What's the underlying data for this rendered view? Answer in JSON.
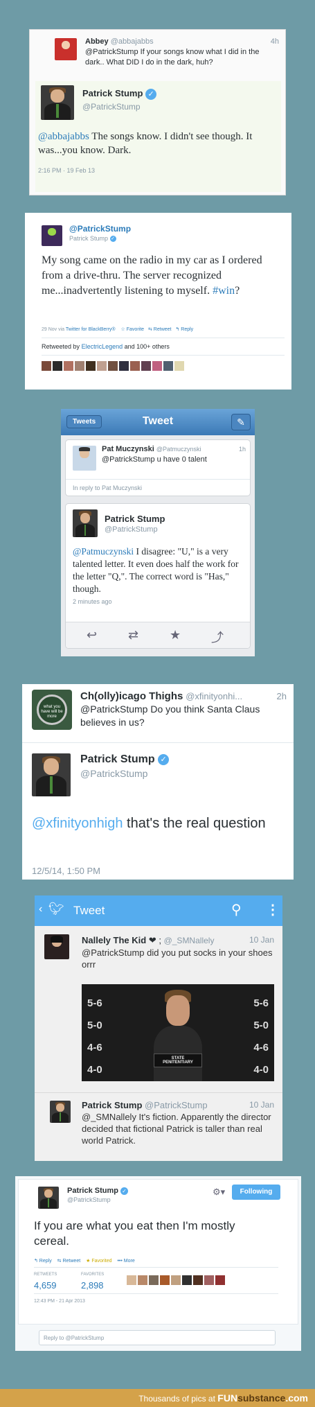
{
  "tweet1": {
    "reply_name": "Abbey",
    "reply_handle": "@abbajabbs",
    "reply_time": "4h",
    "reply_text": "@PatrickStump If your songs know what I did in the dark.. What DID I do in the dark, huh?",
    "name": "Patrick Stump",
    "handle": "@PatrickStump",
    "mention": "@abbajabbs",
    "text": " The songs know. I didn't see though. It was...you know. Dark.",
    "timestamp": "2:16 PM · 19 Feb 13"
  },
  "tweet2": {
    "handle": "@PatrickStump",
    "name": "Patrick Stump",
    "text": "My song came on the radio in my car as I ordered from a drive-thru. The server recognized me...inadvertently listening to myself. ",
    "hashtag": "#win",
    "text_end": "?",
    "meta": "29 Nov via",
    "client": "Twitter for BlackBerry®",
    "favorite": "☆ Favorite",
    "retweet": "⇆ Retweet",
    "reply": "↰ Reply",
    "retweeted_prefix": "Retweeted by",
    "retweeted_by": "ElectricLegend",
    "retweeted_suffix": "and 100+ others"
  },
  "tweet3": {
    "back_label": "Tweets",
    "title": "Tweet",
    "reply_name": "Pat Muczynski",
    "reply_handle": "@Patmuczynski",
    "reply_time": "1h",
    "reply_text": "@PatrickStump u have 0 talent",
    "in_reply": "In reply to Pat Muczynski",
    "name": "Patrick Stump",
    "handle": "@PatrickStump",
    "mention": "@Patmuczynski",
    "text": " I disagree: \"U,\" is a very talented letter. It even does half the work for the letter \"Q,\". The correct word is \"Has,\" though.",
    "time": "2 minutes ago"
  },
  "tweet4": {
    "reply_name": "Ch(olly)icago Thighs",
    "reply_handle": "@xfinityonhi...",
    "reply_time": "2h",
    "reply_text": "@PatrickStump Do you think Santa Claus believes in us?",
    "avatar_text": "what you have will be more",
    "name": "Patrick Stump",
    "handle": "@PatrickStump",
    "mention": "@xfinityonhigh",
    "text": " that's the real question",
    "timestamp": "12/5/14, 1:50 PM"
  },
  "tweet5": {
    "title": "Tweet",
    "reply_name": "Nallely The Kid",
    "reply_symbol": "❤ ;",
    "reply_handle": "@_SMNallely",
    "reply_time": "10 Jan",
    "reply_text": "@PatrickStump did you put socks in your shoes orrr",
    "mug_marks_left": [
      "5-6",
      "5-0",
      "4-6",
      "4-0"
    ],
    "mug_marks_right": [
      "5-6",
      "5-0",
      "4-6",
      "4-0"
    ],
    "mug_sign": "STATE PENITENTIARY",
    "name": "Patrick Stump",
    "handle": "@PatrickStump",
    "time": "10 Jan",
    "text": "@_SMNallely It's fiction. Apparently the director decided that fictional Patrick is taller than real world Patrick."
  },
  "tweet6": {
    "name": "Patrick Stump",
    "handle": "@PatrickStump",
    "follow_label": "Following",
    "text": "If you are what you eat then I'm mostly cereal.",
    "reply": "↰ Reply",
    "retweet": "⇆ Retweet",
    "favorited": "★ Favorited",
    "more": "••• More",
    "retweets_label": "RETWEETS",
    "retweets": "4,659",
    "favorites_label": "FAVORITES",
    "favorites": "2,898",
    "timestamp": "12:43 PM - 21 Apr 2013",
    "reply_placeholder": "Reply to @PatrickStump"
  },
  "footer": {
    "text": "Thousands of pics at",
    "brand_fun": "FUN",
    "brand_sub": "substance",
    "brand_com": ".com"
  }
}
